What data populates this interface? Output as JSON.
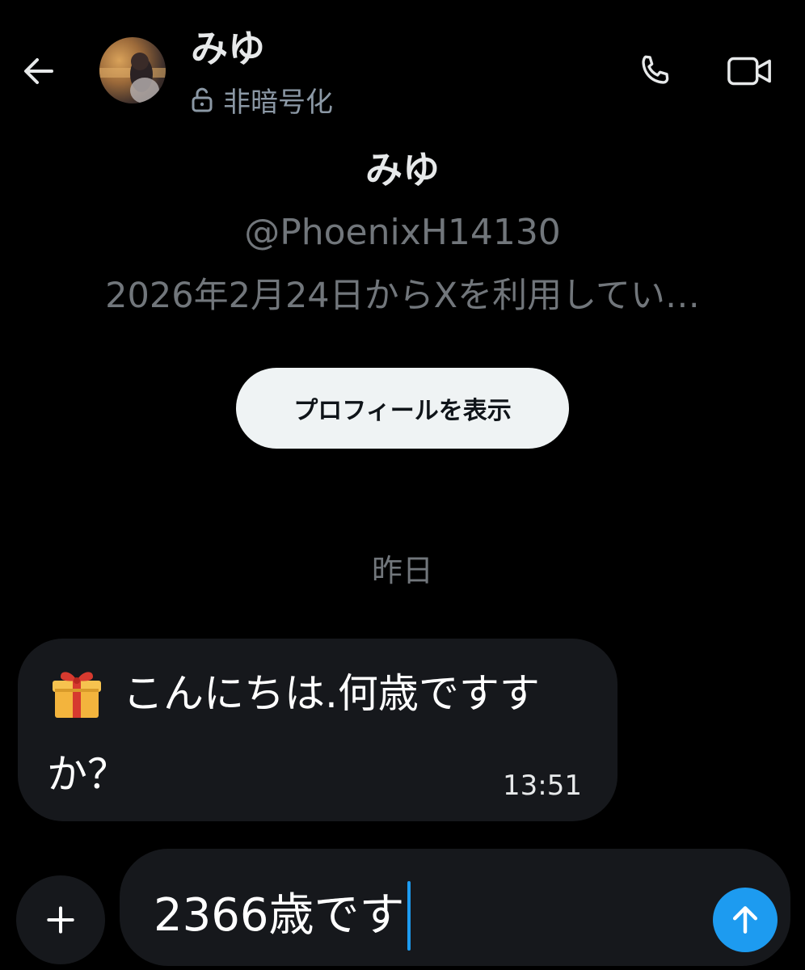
{
  "header": {
    "back_icon": "arrow-left-icon",
    "name": "みゆ",
    "encryption_icon": "unlock-icon",
    "encryption_label": "非暗号化",
    "phone_icon": "phone-icon",
    "video_icon": "video-camera-icon"
  },
  "profile": {
    "name": "みゆ",
    "handle": "@PhoenixH14130",
    "joined": "2026年2月24日からXを利用してい…",
    "view_profile_label": "プロフィールを表示"
  },
  "conversation": {
    "date_separator": "昨日",
    "messages": [
      {
        "icon": "gift-icon",
        "line1": "こんにちは.何歳ですす",
        "line2": "か？",
        "time": "13:51"
      }
    ]
  },
  "composer": {
    "add_icon": "plus-icon",
    "value": "2366歳です",
    "send_icon": "arrow-up-icon"
  },
  "colors": {
    "background": "#000000",
    "accent": "#1d9bf0",
    "bubble": "#16181c",
    "secondary_text": "#71767b"
  }
}
